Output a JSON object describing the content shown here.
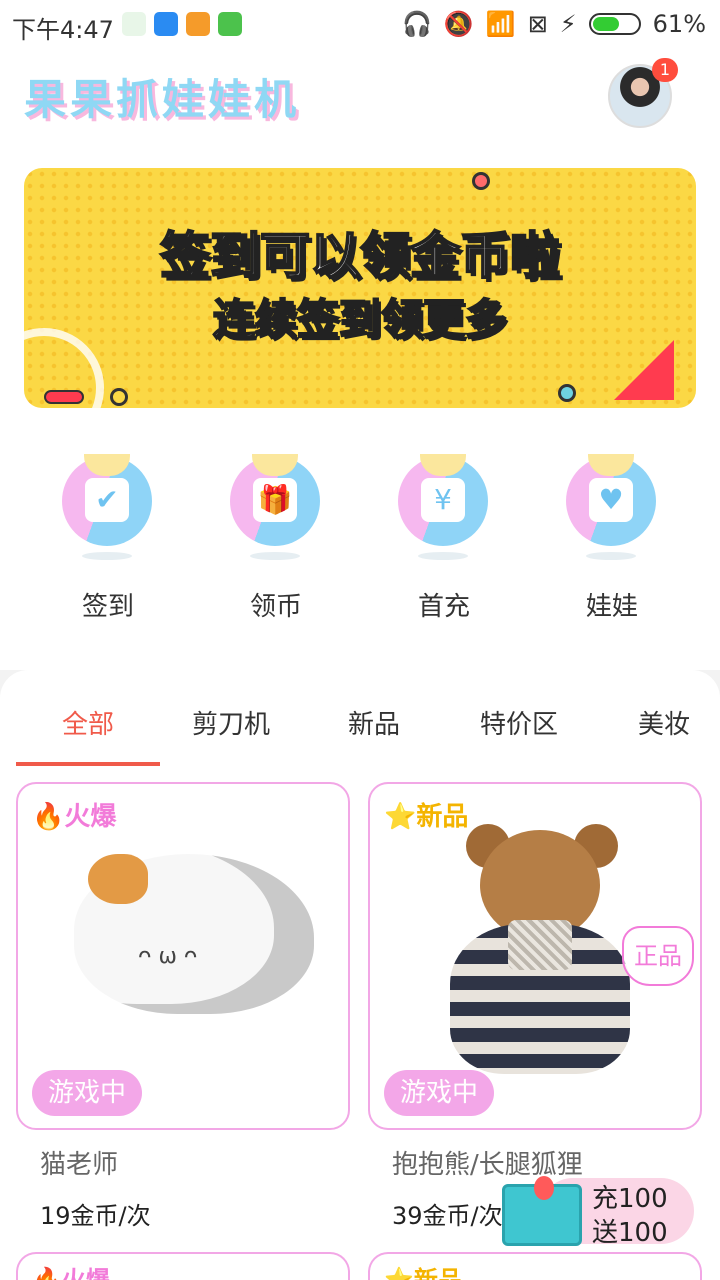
{
  "status_bar": {
    "time": "下午4:47",
    "battery": "61%",
    "battery_level": 0.61
  },
  "header": {
    "title": "果果抓娃娃机",
    "notification_count": "1"
  },
  "banner": {
    "line1": "签到可以领金币啦",
    "line2": "连续签到领更多",
    "bg_color": "#fbd845"
  },
  "quick_menu": [
    {
      "label": "签到",
      "icon": "calendar-check-icon"
    },
    {
      "label": "领币",
      "icon": "gift-icon"
    },
    {
      "label": "首充",
      "icon": "yen-ticket-icon"
    },
    {
      "label": "娃娃",
      "icon": "teddy-bear-icon"
    }
  ],
  "tabs": [
    {
      "label": "全部",
      "active": true
    },
    {
      "label": "剪刀机"
    },
    {
      "label": "新品"
    },
    {
      "label": "特价区"
    },
    {
      "label": "美妆"
    }
  ],
  "products": [
    {
      "tag": "火爆",
      "status": "游戏中",
      "name": "猫老师",
      "price": "19金币/次"
    },
    {
      "tag": "新品",
      "status": "游戏中",
      "badge": "正品",
      "name": "抱抱熊/长腿狐狸",
      "price": "39金币/次"
    }
  ],
  "next_products": [
    {
      "tag": "火爆"
    },
    {
      "tag": "新品"
    }
  ],
  "promo": {
    "line1": "充100",
    "line2": "送100"
  },
  "colors": {
    "accent": "#f05a4a",
    "card_border": "#f2a7e6",
    "hot": "#f27bd9",
    "new": "#f4b400"
  }
}
